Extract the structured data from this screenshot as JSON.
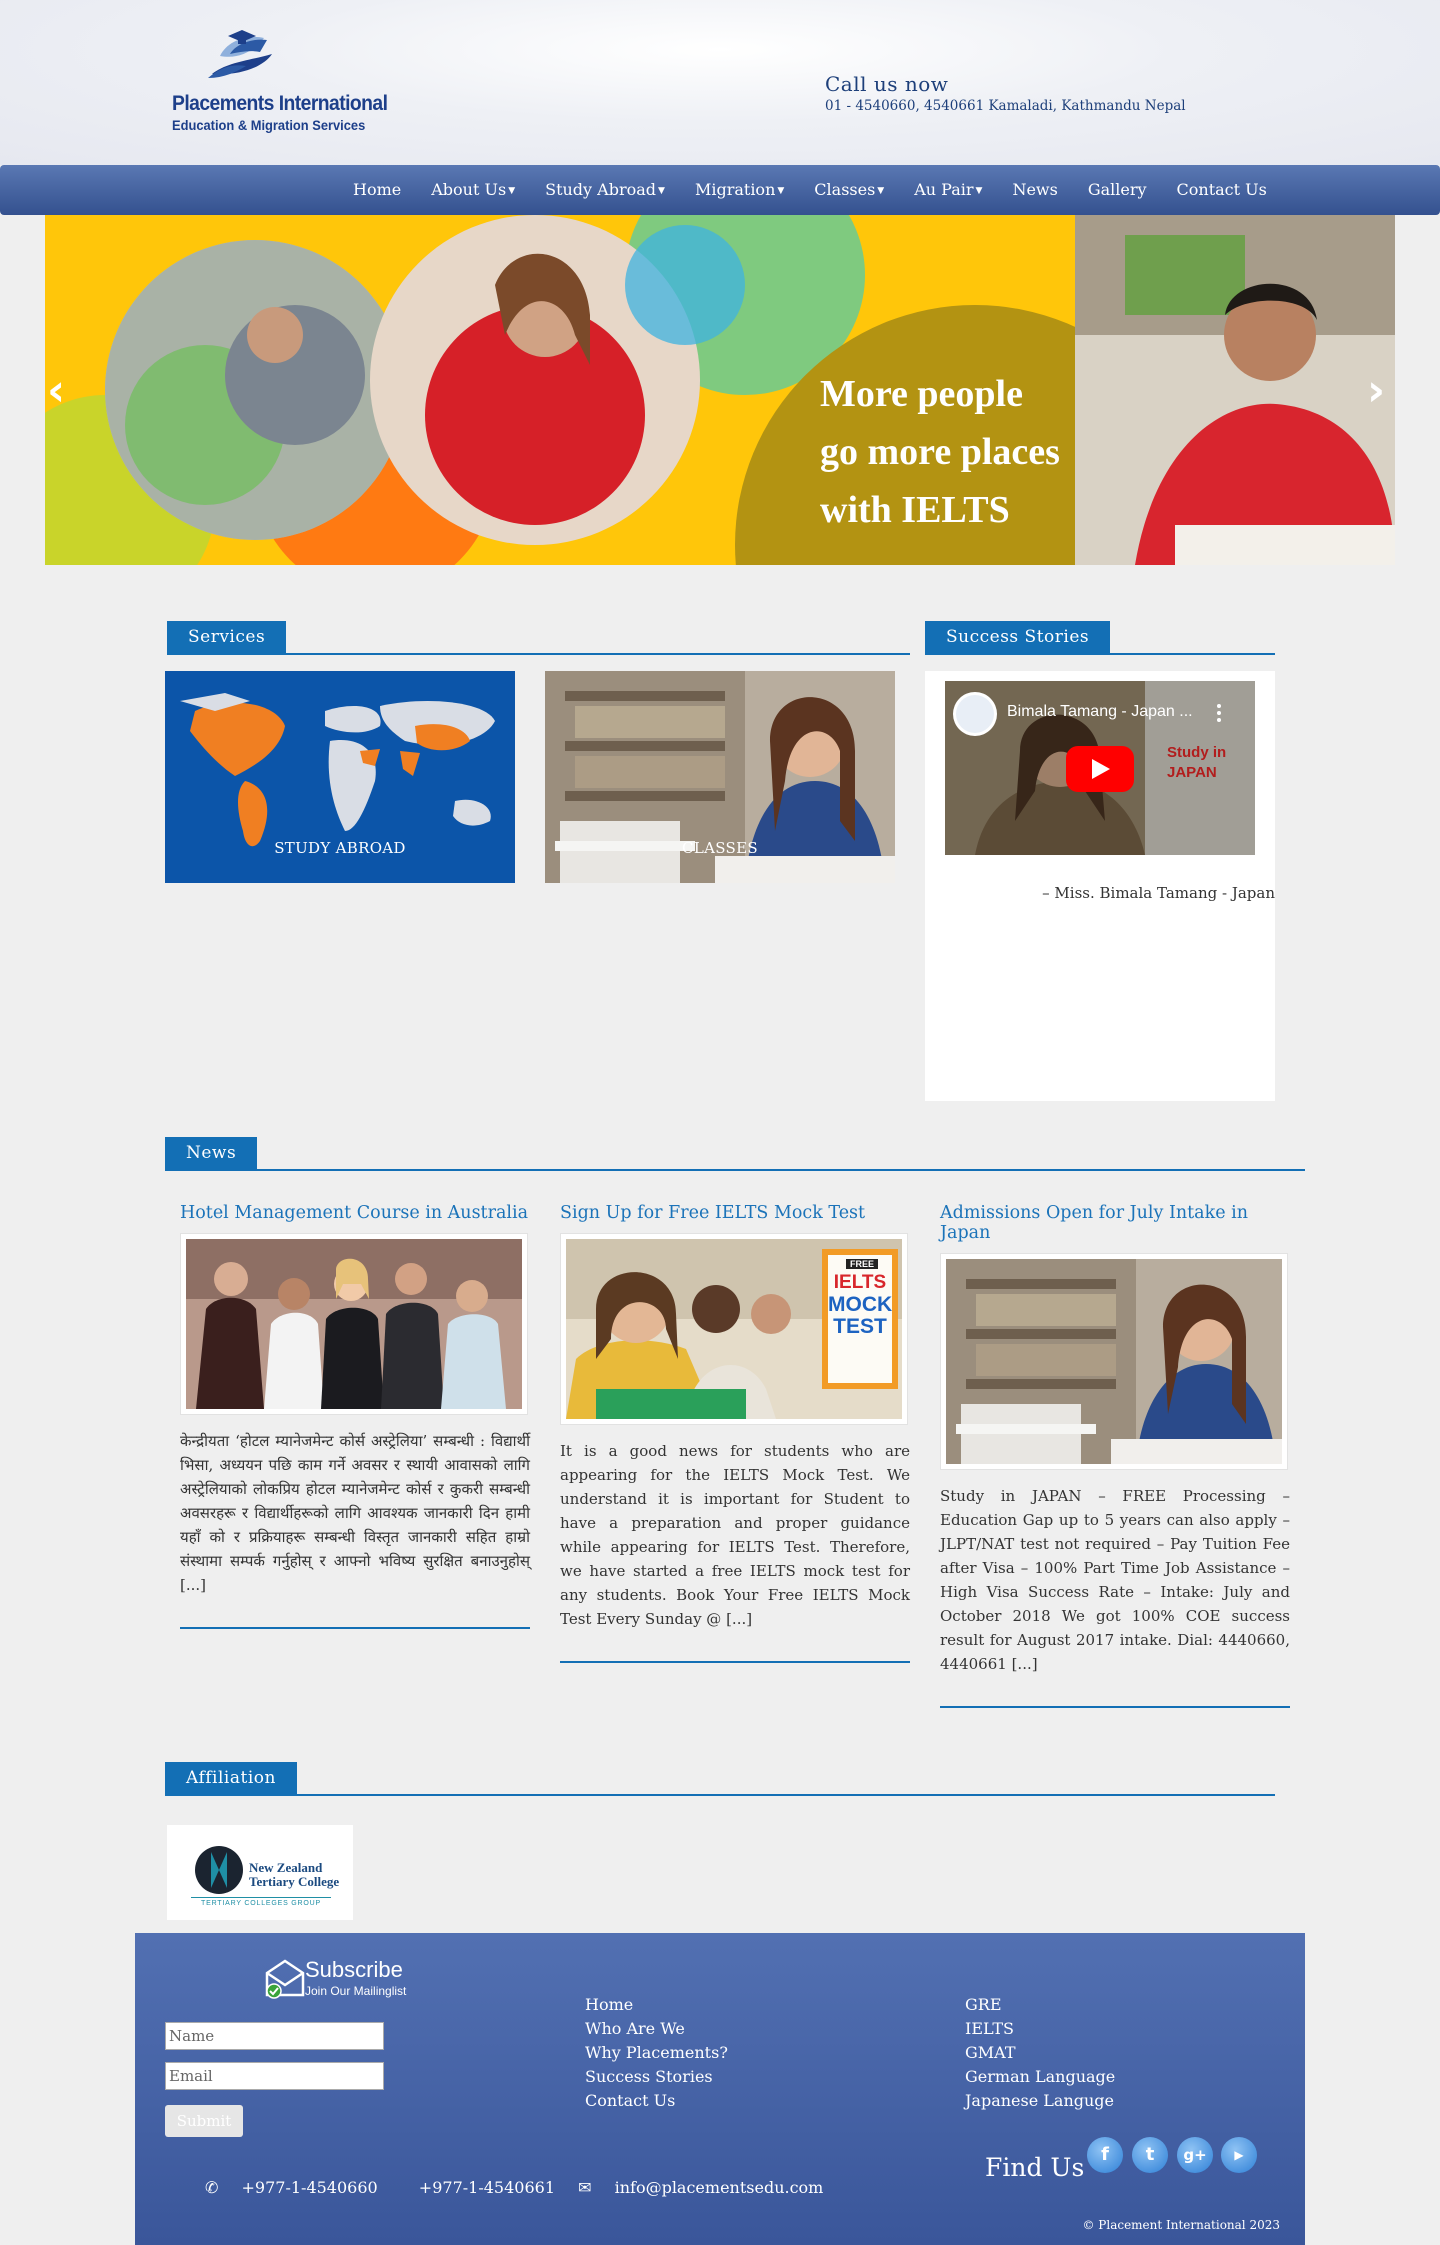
{
  "header": {
    "logo_name": "Placements International",
    "logo_sub": "Education & Migration Services",
    "call_label": "Call us now",
    "address": "01 - 4540660, 4540661 Kamaladi, Kathmandu Nepal"
  },
  "nav": {
    "items": [
      "Home",
      "About Us",
      "Study Abroad",
      "Migration",
      "Classes",
      "Au Pair",
      "News",
      "Gallery",
      "Contact Us"
    ]
  },
  "hero": {
    "line1": "More people",
    "line2": "go more places",
    "line3": "with IELTS",
    "prev": "‹",
    "next": "›"
  },
  "services": {
    "title": "Services",
    "items": [
      "STUDY ABROAD",
      "CLASSES"
    ]
  },
  "success": {
    "title": "Success Stories",
    "video_title": "Bimala Tamang - Japan ...",
    "video_badge": "Study in JAPAN",
    "quote": "– Miss. Bimala Tamang - Japan"
  },
  "news": {
    "title": "News",
    "items": [
      {
        "title": "Hotel Management Course in Australia",
        "text": "केन्द्रीयता ‘होटल म्यानेजमेन्ट कोर्स अस्ट्रेलिया’ सम्बन्धी : विद्यार्थी भिसा, अध्ययन पछि काम गर्ने अवसर र स्थायी आवासको लागि अस्ट्रेलियाको लोकप्रिय होटल म्यानेजमेन्ट कोर्स र कुकरी सम्बन्धी अवसरहरू र विद्यार्थीहरूको लागि आवश्यक जानकारी दिन हामी यहाँ को र प्रक्रियाहरू सम्बन्धी विस्तृत जानकारी सहित हाम्रो संस्थामा सम्पर्क गर्नुहोस् र आफ्नो भविष्य सुरक्षित बनाउनुहोस् [...]"
      },
      {
        "title": "Sign Up for Free IELTS Mock Test",
        "text": "It is a good news for students who are appearing for the IELTS Mock Test. We understand it is important for Student to have a preparation and proper guidance while appearing for IELTS Test. Therefore, we have started a free IELTS mock test for any students. Book Your Free IELTS Mock Test Every Sunday @ [...]",
        "badge_top": "FREE",
        "badge_1": "IELTS",
        "badge_2": "MOCK",
        "badge_3": "TEST"
      },
      {
        "title": "Admissions Open for July Intake in Japan",
        "text": "Study in JAPAN – FREE Processing – Education Gap up to 5 years can also apply – JLPT/NAT test not required – Pay Tuition Fee after Visa – 100% Part Time Job Assistance – High Visa Success Rate – Intake: July and October 2018 We got 100% COE success result for August 2017 intake. Dial: 4440660, 4440661 [...]"
      }
    ]
  },
  "affiliation": {
    "title": "Affiliation",
    "logo_line1": "New Zealand",
    "logo_line2": "Tertiary College",
    "logo_group": "TERTIARY COLLEGES GROUP"
  },
  "footer": {
    "subscribe_title": "Subscribe",
    "subscribe_sub": "Join Our Mailinglist",
    "name_placeholder": "Name",
    "email_placeholder": "Email",
    "submit_label": "Submit",
    "links_1": [
      "Home",
      "Who Are We",
      "Why Placements?",
      "Success Stories",
      "Contact Us"
    ],
    "links_2": [
      "GRE",
      "IELTS",
      "GMAT",
      "German Language",
      "Japanese Languge"
    ],
    "phone_1": "+977-1-4540660",
    "phone_2": "+977-1-4540661",
    "email": "info@placementsedu.com",
    "find_us": "Find Us",
    "copyright": "© Placement International 2023"
  },
  "colors": {
    "nav": "#3d5a98",
    "accent": "#136fb5",
    "footer": "#4663a6",
    "hero": "#ffc60a"
  }
}
